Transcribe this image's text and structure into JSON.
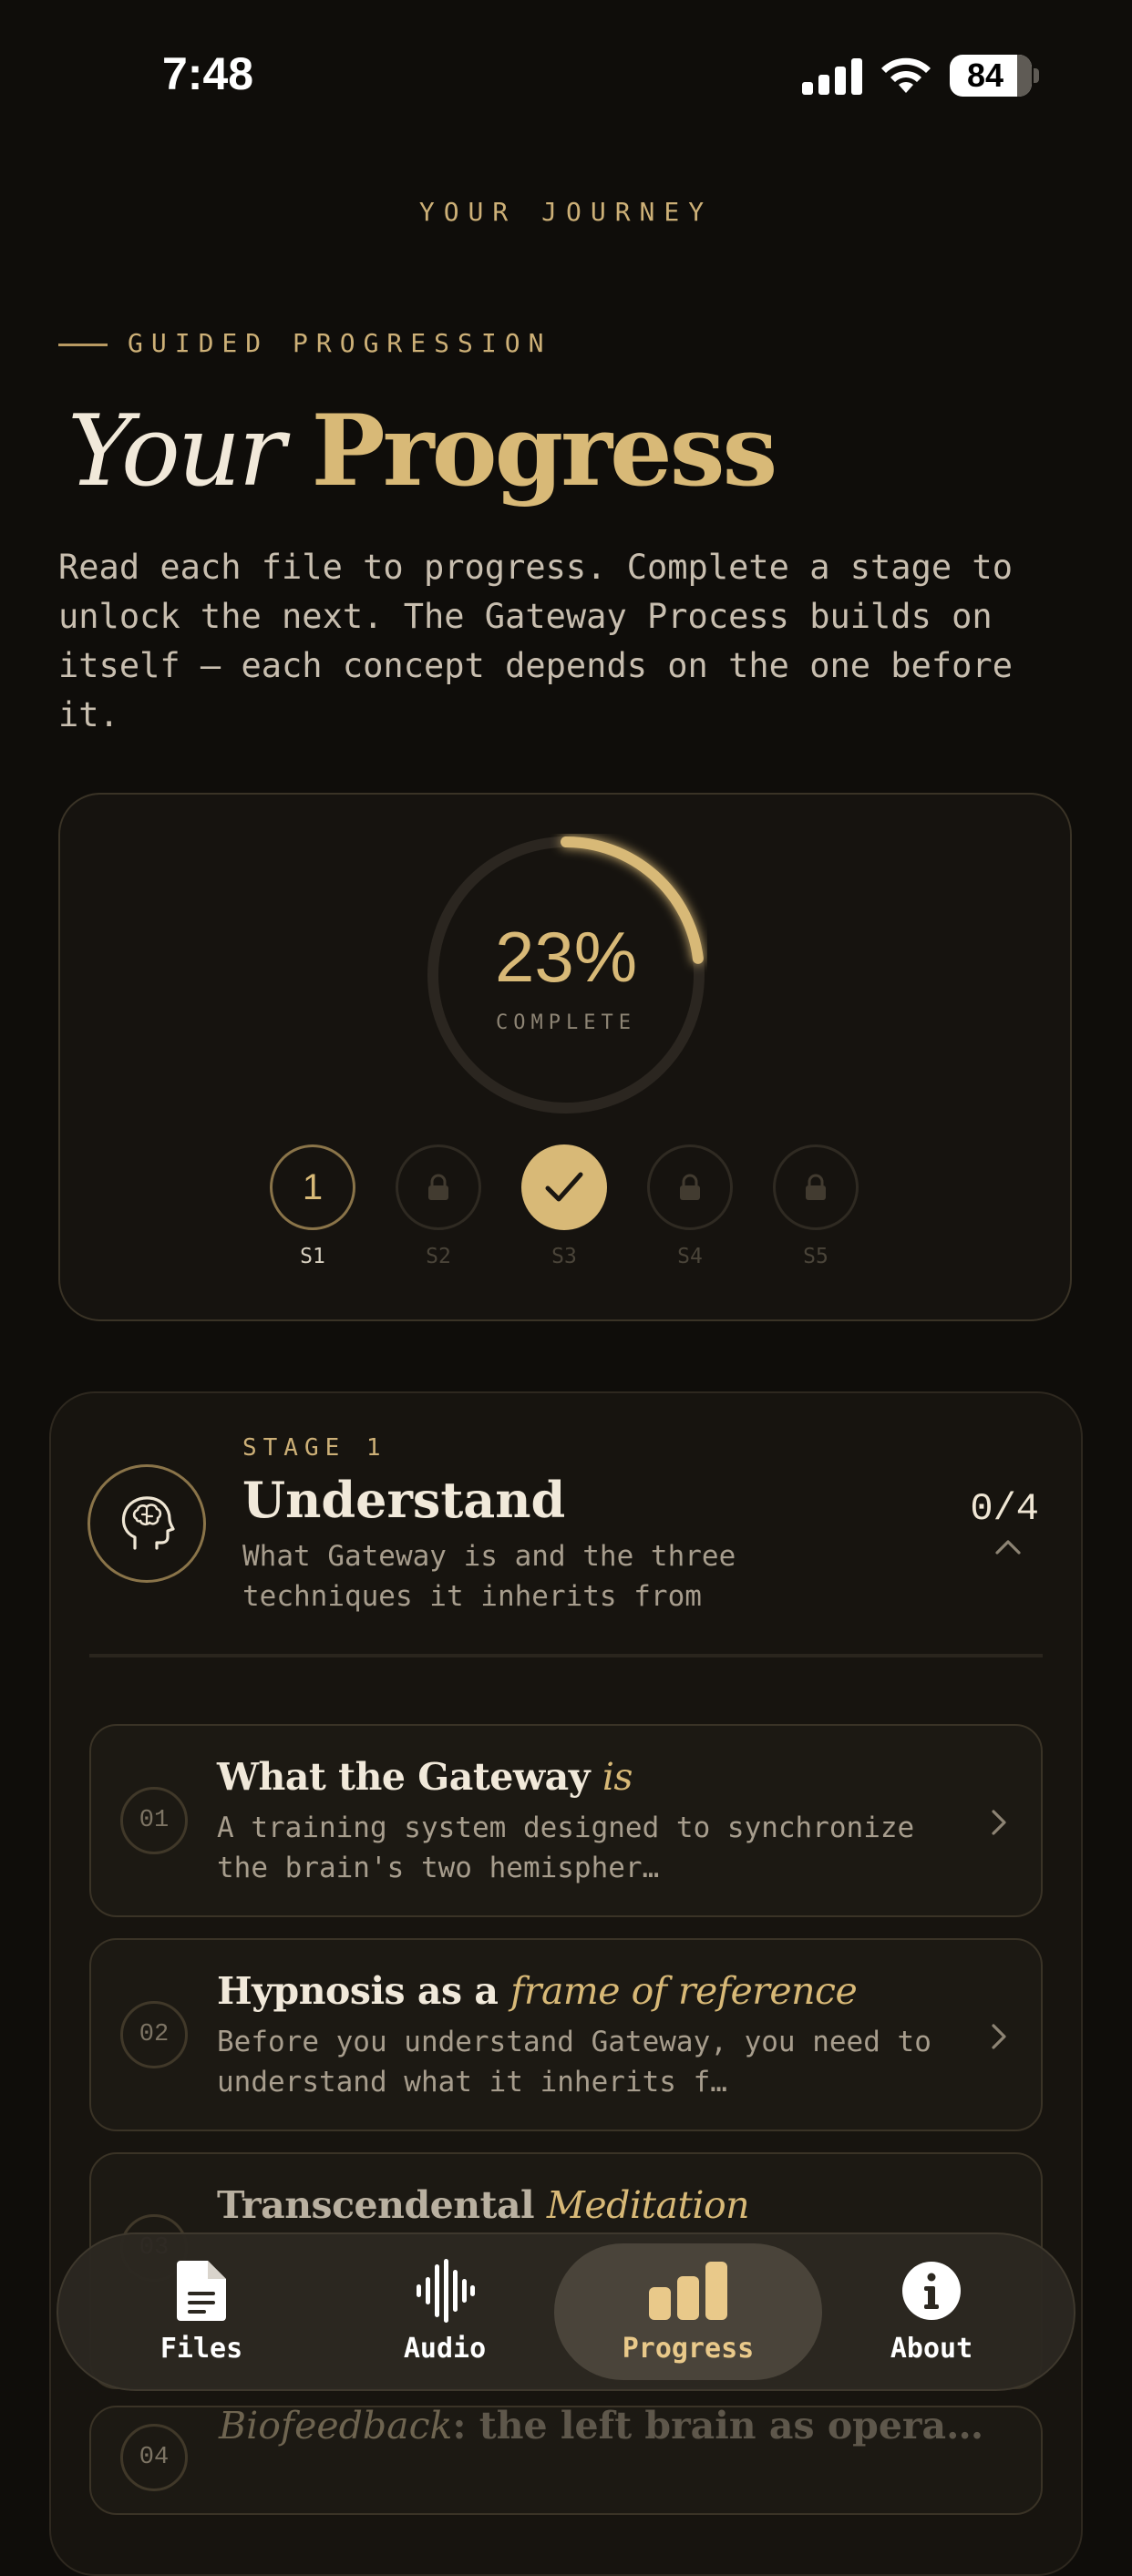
{
  "status_bar": {
    "time": "7:48",
    "battery": "84",
    "battery_level_percent": 84,
    "icons": [
      "cellular-signal-icon",
      "wifi-icon",
      "battery-icon"
    ]
  },
  "header": {
    "screen_title": "YOUR JOURNEY"
  },
  "hero": {
    "eyebrow": "GUIDED PROGRESSION",
    "title_word_1": "Your",
    "title_word_2": "Progress",
    "intro": "Read each file to progress. Complete a stage to unlock the next. The Gateway Process builds on itself — each concept depends on the one before it."
  },
  "progress": {
    "percent_value": 23,
    "percent_text": "23%",
    "label": "COMPLETE",
    "stages": [
      {
        "label": "S1",
        "display": "1",
        "state": "active"
      },
      {
        "label": "S2",
        "display": "",
        "state": "locked"
      },
      {
        "label": "S3",
        "display": "",
        "state": "completed"
      },
      {
        "label": "S4",
        "display": "",
        "state": "locked"
      },
      {
        "label": "S5",
        "display": "",
        "state": "locked"
      }
    ]
  },
  "stage": {
    "eyebrow": "STAGE 1",
    "title": "Understand",
    "description": "What Gateway is and the three techniques it inherits from",
    "count": "0/4",
    "icon": "brain-head-icon",
    "lessons": [
      {
        "number": "01",
        "title_main": "What the Gateway",
        "title_accent": "is",
        "description": "A training system designed to synchronize the brain's two hemispher…"
      },
      {
        "number": "02",
        "title_main": "Hypnosis as a",
        "title_accent": "frame of reference",
        "description": "Before you understand Gateway, you need to understand what it inherits f…"
      },
      {
        "number": "03",
        "title_main": "Transcendental",
        "title_accent": "Meditation"
      },
      {
        "number": "04",
        "title_accent": "Biofeedback",
        "title_main": ": the left brain as opera…"
      }
    ]
  },
  "tab_bar": {
    "tabs": [
      {
        "label": "Files",
        "icon": "document-icon",
        "active": false
      },
      {
        "label": "Audio",
        "icon": "waveform-icon",
        "active": false
      },
      {
        "label": "Progress",
        "icon": "bar-chart-icon",
        "active": true
      },
      {
        "label": "About",
        "icon": "info-icon",
        "active": false
      }
    ]
  },
  "colors": {
    "background": "#0f0d0a",
    "accent_gold": "#d8b977",
    "text_primary": "#f1e9da",
    "text_secondary": "#a79d8d"
  }
}
